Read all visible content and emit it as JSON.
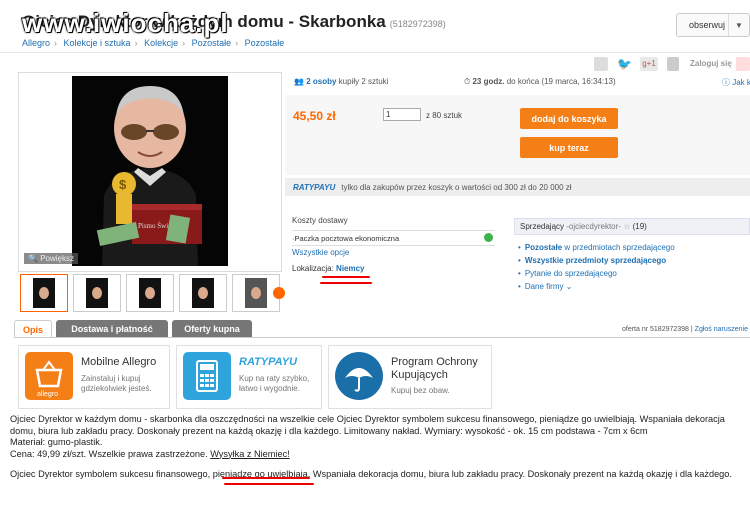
{
  "header": {
    "title": "Ojciec Dyrektor w każdym domu - Skarbonka",
    "watermark": "www.iwiocha.pl",
    "offer_id": "(5182972398)",
    "observe_label": "obserwuj"
  },
  "breadcrumbs": [
    "Allegro",
    "Kolekcje i sztuka",
    "Kolekcje",
    "Pozostałe",
    "Pozostałe"
  ],
  "social": {
    "login_label": "Zaloguj się"
  },
  "gallery": {
    "zoom_label": "Powiększ",
    "photo_text": "Pismo Święte"
  },
  "purchase": {
    "buyers_count": "2 osoby",
    "buyers_text": "kupiły 2 sztuki",
    "time_left": "23 godz.",
    "time_text": "do końca (19 marca, 16:34:13)",
    "share_label": "Jak kupow",
    "price": "45,50 zł",
    "quantity": "1",
    "quantity_of": "z 80 sztuk",
    "add_to_cart": "dodaj do koszyka",
    "buy_now": "kup teraz"
  },
  "raty": {
    "logo": "RATYPAYU",
    "text": "tylko dla zakupów przez koszyk o wartości od 300 zł do 20 000 zł"
  },
  "shipping": {
    "header": "Koszty dostawy",
    "option": "Paczka pocztowa ekonomiczna",
    "all_options": "Wszystkie opcje",
    "location_label": "Lokalizacja:",
    "location_value": "Niemcy"
  },
  "seller": {
    "label": "Sprzedający",
    "name": "-ojciecdyrektor-",
    "rating": "(19)",
    "links": [
      {
        "bold": "Pozostałe",
        "rest": " w przedmiotach sprzedającego"
      },
      {
        "bold": "Wszystkie przedmioty sprzedającego",
        "rest": ""
      },
      {
        "bold": "",
        "rest": "Pytanie do sprzedającego"
      },
      {
        "bold": "",
        "rest": "Dane firmy  ⌄"
      }
    ]
  },
  "tabs": [
    "Opis",
    "Dostawa i płatność",
    "Oferty kupna"
  ],
  "offer_number": "oferta nr 5182972398",
  "report_link": "Zgłoś naruszenie",
  "promos": [
    {
      "title": "Mobilne Allegro",
      "desc": "Zainstaluj i kupuj gdziekolwiek jesteś.",
      "icon_text": "allegro",
      "color": "#f57f17"
    },
    {
      "title": "RATYPAYU",
      "desc": "Kup na raty szybko, łatwo i wygodnie.",
      "icon_text": "",
      "color": "#2ea3dc"
    },
    {
      "title": "Program Ochrony Kupujących",
      "desc": "Kupuj bez obaw.",
      "icon_text": "",
      "color": "#1b6fa8"
    }
  ],
  "description": {
    "p1": "Ojciec Dyrektor w każdym domu - skarbonka dla oszczędności na wszelkie cele Ojciec Dyrektor symbolem sukcesu finansowego, pieniądze go uwielbiają. Wspaniała dekoracja domu, biura lub zakładu pracy. Doskonały prezent na każdą okazję i dla każdego. Limitowany nakład. Wymiary: wysokość - ok. 15 cm podstawa - 7cm x 6cm",
    "material": "Materiał: gumo-plastik.",
    "price_line": "Cena: 49,99 zł/szt. Wszelkie prawa zastrzeżone.",
    "shipping_line": "Wysyłka z Niemiec!",
    "p2": "Ojciec Dyrektor symbolem sukcesu finansowego, pieniądze go uwielbiają. Wspaniała dekoracja domu, biura lub zakładu pracy. Doskonały prezent na każdą okazję i dla każdego."
  }
}
